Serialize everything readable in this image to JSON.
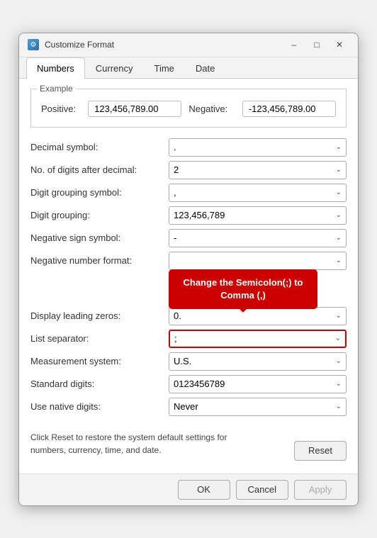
{
  "window": {
    "title": "Customize Format",
    "icon": "⚙"
  },
  "tabs": [
    {
      "label": "Numbers",
      "active": true
    },
    {
      "label": "Currency",
      "active": false
    },
    {
      "label": "Time",
      "active": false
    },
    {
      "label": "Date",
      "active": false
    }
  ],
  "example": {
    "legend": "Example",
    "positive_label": "Positive:",
    "positive_value": "123,456,789.00",
    "negative_label": "Negative:",
    "negative_value": "-123,456,789.00"
  },
  "fields": [
    {
      "label": "Decimal symbol:",
      "value": ".",
      "id": "decimal-symbol"
    },
    {
      "label": "No. of digits after decimal:",
      "value": "2",
      "id": "digits-after-decimal"
    },
    {
      "label": "Digit grouping symbol:",
      "value": ",",
      "id": "digit-grouping-symbol"
    },
    {
      "label": "Digit grouping:",
      "value": "123,456,789",
      "id": "digit-grouping"
    },
    {
      "label": "Negative sign symbol:",
      "value": "-",
      "id": "negative-sign"
    },
    {
      "label": "Negative number format:",
      "value": "",
      "id": "negative-number-format",
      "tooltip": true
    },
    {
      "label": "Display leading zeros:",
      "value": "0.",
      "id": "display-leading-zeros"
    },
    {
      "label": "List separator:",
      "value": ";",
      "id": "list-separator",
      "highlighted": true
    },
    {
      "label": "Measurement system:",
      "value": "U.S.",
      "id": "measurement-system"
    },
    {
      "label": "Standard digits:",
      "value": "0123456789",
      "id": "standard-digits"
    },
    {
      "label": "Use native digits:",
      "value": "Never",
      "id": "use-native-digits"
    }
  ],
  "tooltip": {
    "text": "Change the Semicolon(;) to Comma (,)"
  },
  "footer": {
    "reset_text": "Click Reset to restore the system default settings for\nnumbers, currency, time, and date.",
    "reset_label": "Reset",
    "ok_label": "OK",
    "cancel_label": "Cancel",
    "apply_label": "Apply"
  },
  "colors": {
    "accent": "#cc0000",
    "highlight_border": "#cc0000"
  }
}
